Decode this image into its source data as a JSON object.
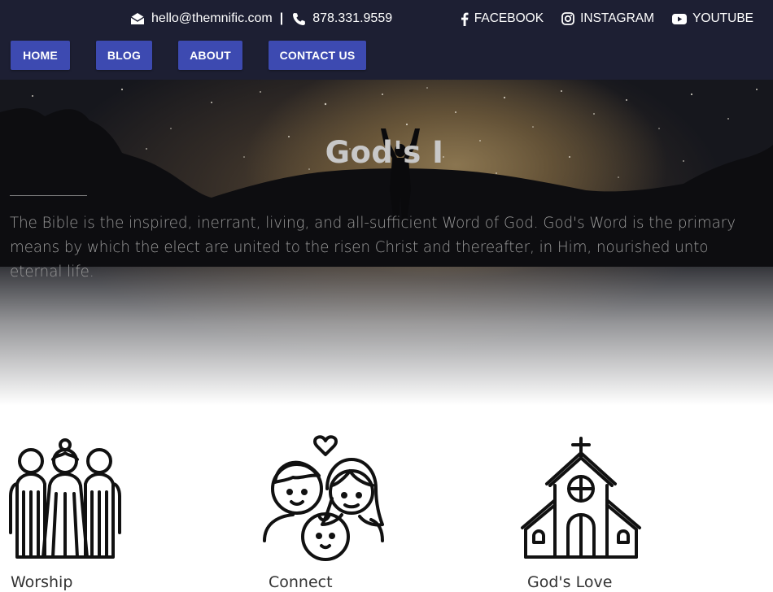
{
  "header": {
    "email": "hello@themnific.com",
    "separator": "|",
    "phone": "878.331.9559",
    "social": [
      {
        "label": "FACEBOOK",
        "icon": "facebook-icon"
      },
      {
        "label": "INSTAGRAM",
        "icon": "instagram-icon"
      },
      {
        "label": "YOUTUBE",
        "icon": "youtube-icon"
      }
    ]
  },
  "nav": {
    "items": [
      {
        "label": "HOME"
      },
      {
        "label": "BLOG"
      },
      {
        "label": "ABOUT"
      },
      {
        "label": "CONTACT US"
      }
    ]
  },
  "hero": {
    "title": "God's I",
    "text": "The Bible is the inspired, inerrant, living, and all-sufficient Word of God. God's Word is the primary means by which the elect are united to the risen Christ and thereafter, in Him, nourished unto eternal life."
  },
  "features": [
    {
      "label": "Worship",
      "icon": "worship-people-icon"
    },
    {
      "label": "Connect",
      "icon": "family-heart-icon"
    },
    {
      "label": "God's Love",
      "icon": "church-icon"
    }
  ],
  "colors": {
    "header_bg": "#1d1f33",
    "nav_button": "#3d4ab1"
  }
}
